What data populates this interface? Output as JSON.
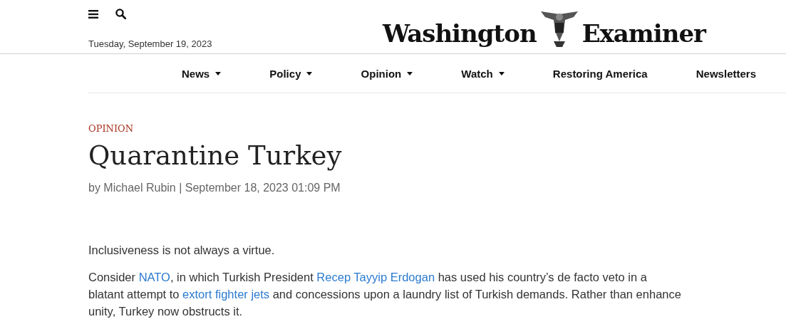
{
  "header": {
    "date": "Tuesday, September 19, 2023",
    "logo": {
      "left": "Washington",
      "right": "Examiner"
    }
  },
  "nav": [
    {
      "label": "News",
      "has_menu": true
    },
    {
      "label": "Policy",
      "has_menu": true
    },
    {
      "label": "Opinion",
      "has_menu": true
    },
    {
      "label": "Watch",
      "has_menu": true
    },
    {
      "label": "Restoring America",
      "has_menu": false
    },
    {
      "label": "Newsletters",
      "has_menu": false
    }
  ],
  "article": {
    "section": "OPINION",
    "title": "Quarantine Turkey",
    "byline": "by Michael Rubin | September 18, 2023 01:09 PM",
    "paragraphs": [
      [
        {
          "text": "Inclusiveness is not always a virtue.",
          "link": false
        }
      ],
      [
        {
          "text": "Consider ",
          "link": false
        },
        {
          "text": "NATO",
          "link": true
        },
        {
          "text": ", in which Turkish President ",
          "link": false
        },
        {
          "text": "Recep Tayyip Erdogan",
          "link": true
        },
        {
          "text": " has used his country’s de facto veto in a blatant attempt to ",
          "link": false
        },
        {
          "text": "extort fighter jets",
          "link": true
        },
        {
          "text": " and concessions upon a laundry list of Turkish demands. Rather than enhance unity, Turkey now obstructs it.",
          "link": false
        }
      ]
    ]
  }
}
